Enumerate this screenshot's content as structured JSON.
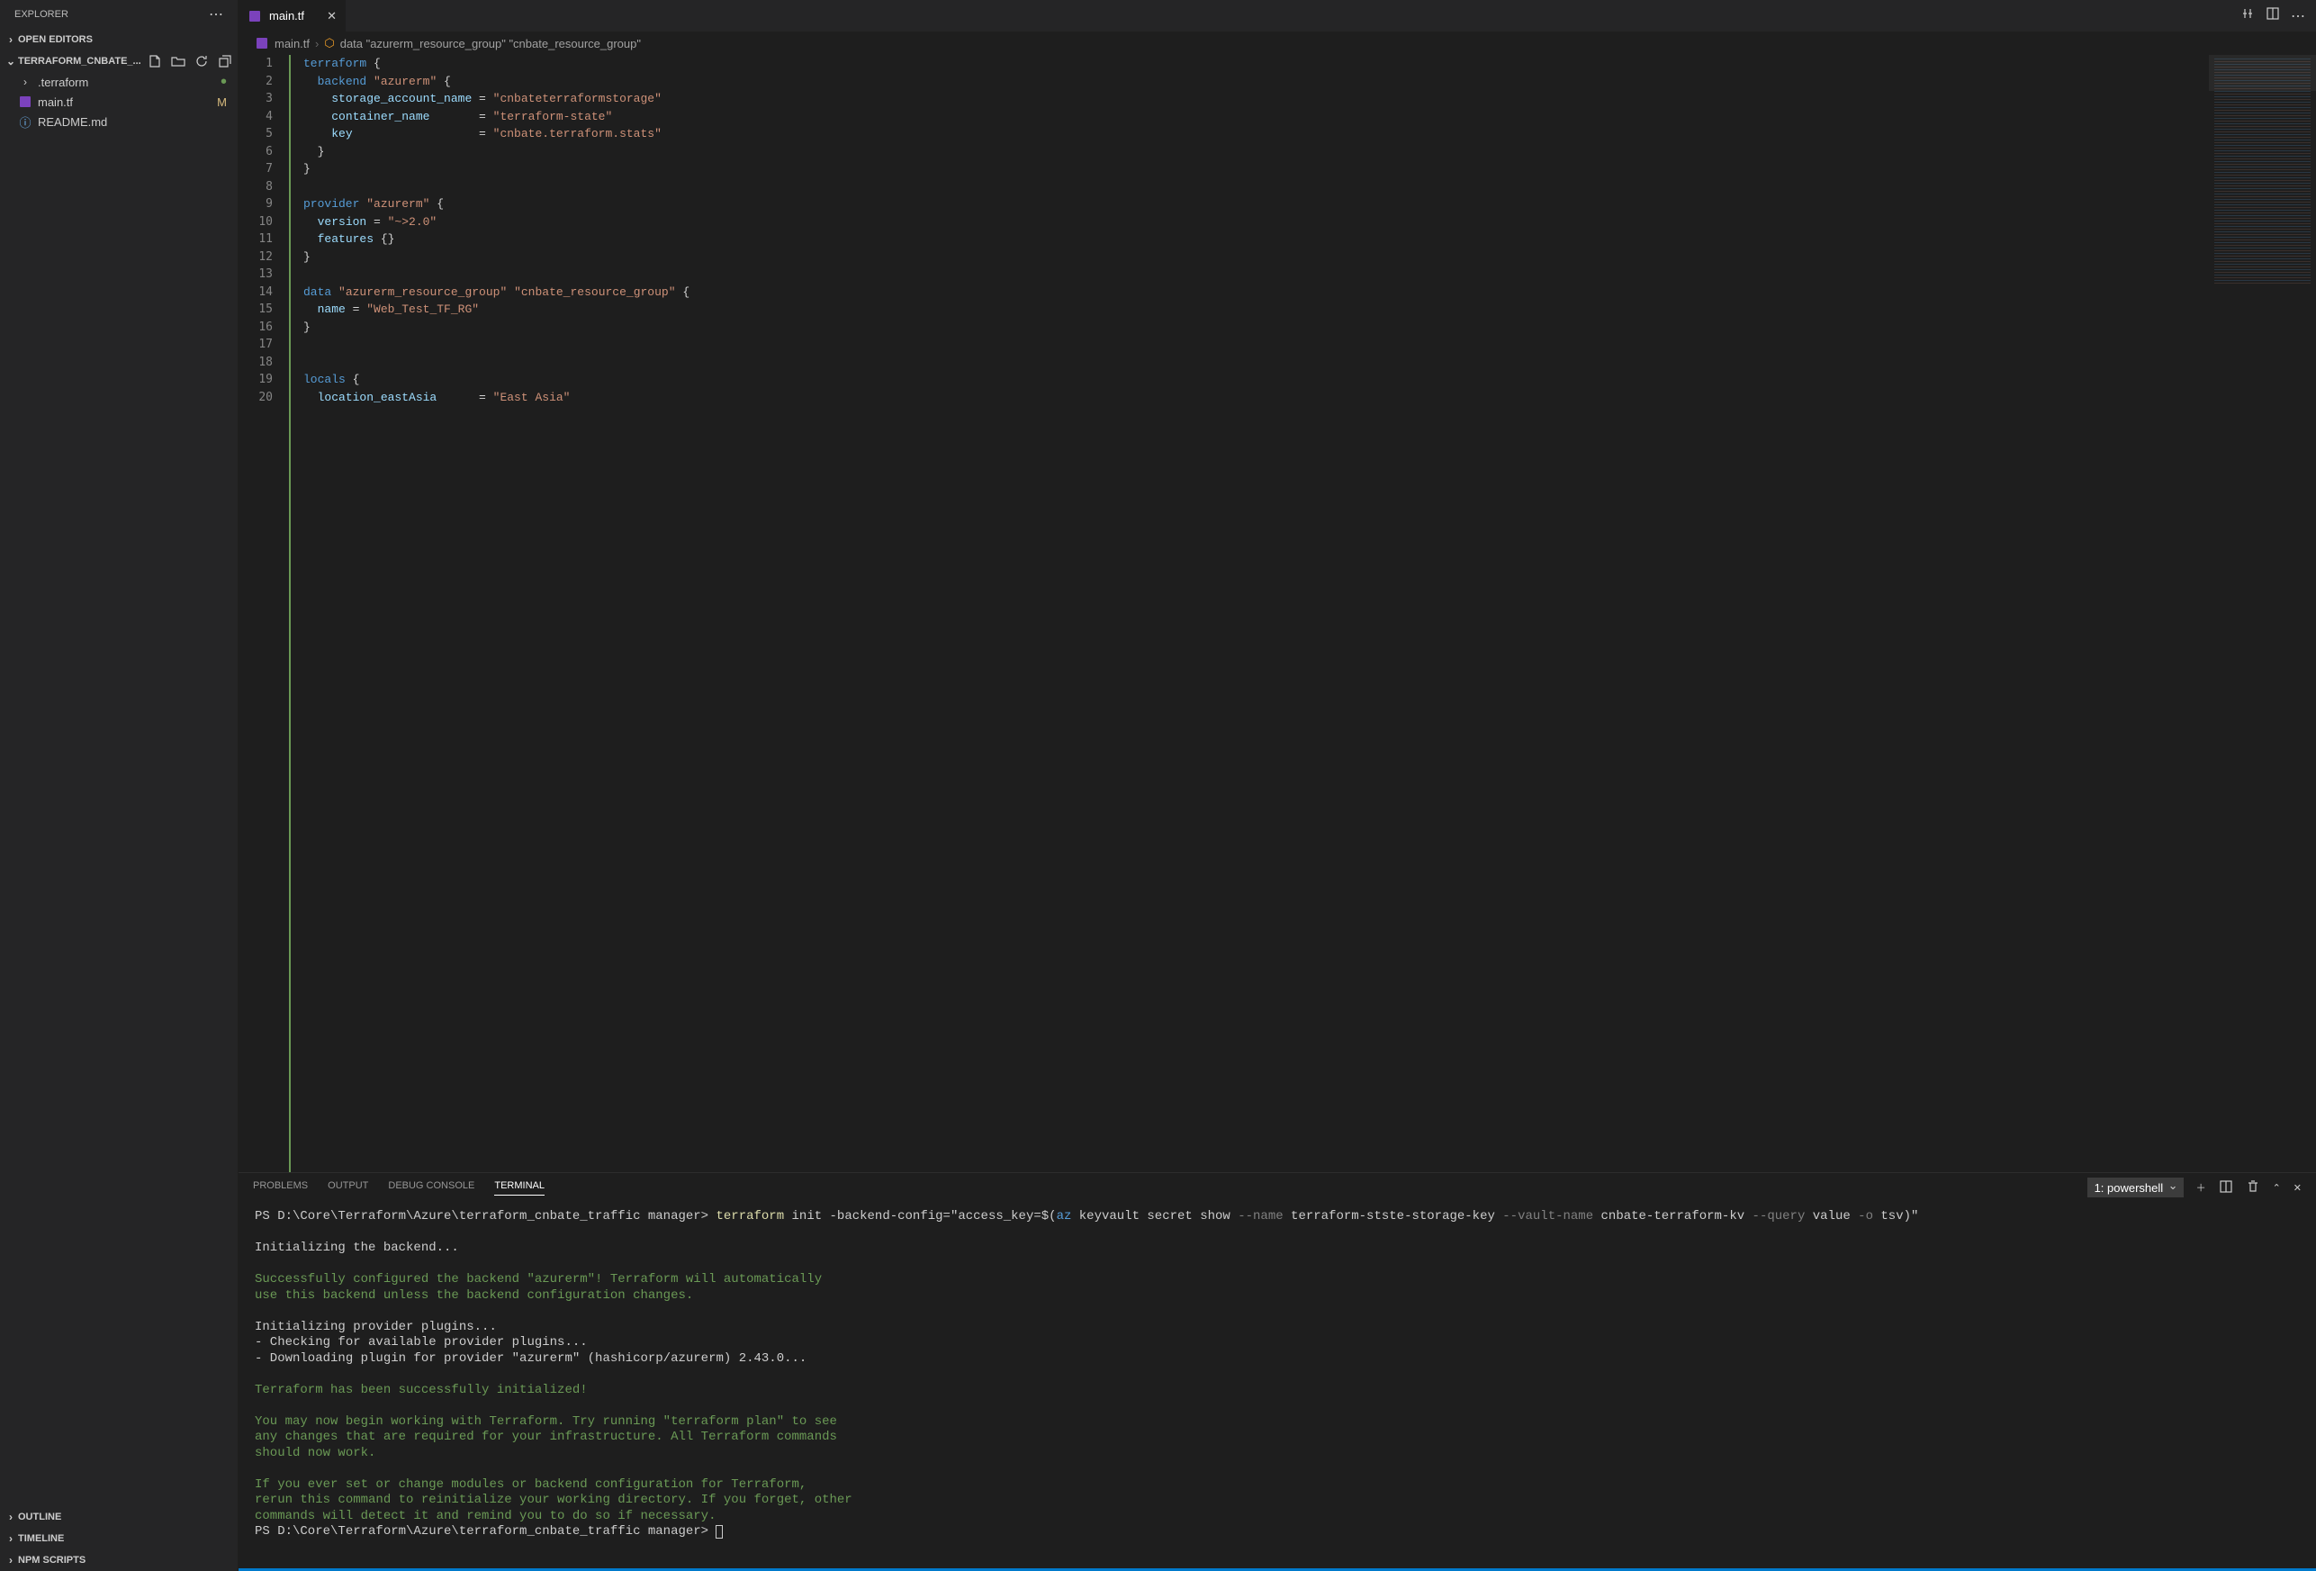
{
  "sidebar": {
    "title": "EXPLORER",
    "open_editors": "OPEN EDITORS",
    "project_name": "TERRAFORM_CNBATE_...",
    "files": [
      {
        "name": ".terraform",
        "type": "folder",
        "badge": "dot"
      },
      {
        "name": "main.tf",
        "type": "tf",
        "badge": "M"
      },
      {
        "name": "README.md",
        "type": "readme",
        "badge": ""
      }
    ],
    "outline": "OUTLINE",
    "timeline": "TIMELINE",
    "npm_scripts": "NPM SCRIPTS"
  },
  "tabs": {
    "active": "main.tf"
  },
  "breadcrumb": {
    "file": "main.tf",
    "symbol": "data \"azurerm_resource_group\" \"cnbate_resource_group\""
  },
  "code": {
    "lines": [
      [
        [
          "kw",
          "terraform"
        ],
        [
          "punct",
          " {"
        ]
      ],
      [
        [
          "punct",
          "  "
        ],
        [
          "kw",
          "backend"
        ],
        [
          "punct",
          " "
        ],
        [
          "str",
          "\"azurerm\""
        ],
        [
          "punct",
          " {"
        ]
      ],
      [
        [
          "punct",
          "    "
        ],
        [
          "prop",
          "storage_account_name"
        ],
        [
          "punct",
          " = "
        ],
        [
          "str",
          "\"cnbateterraformstorage\""
        ]
      ],
      [
        [
          "punct",
          "    "
        ],
        [
          "prop",
          "container_name"
        ],
        [
          "punct",
          "       = "
        ],
        [
          "str",
          "\"terraform-state\""
        ]
      ],
      [
        [
          "punct",
          "    "
        ],
        [
          "prop",
          "key"
        ],
        [
          "punct",
          "                  = "
        ],
        [
          "str",
          "\"cnbate.terraform.stats\""
        ]
      ],
      [
        [
          "punct",
          "  }"
        ]
      ],
      [
        [
          "punct",
          "}"
        ]
      ],
      [
        [
          "punct",
          ""
        ]
      ],
      [
        [
          "kw",
          "provider"
        ],
        [
          "punct",
          " "
        ],
        [
          "str",
          "\"azurerm\""
        ],
        [
          "punct",
          " {"
        ]
      ],
      [
        [
          "punct",
          "  "
        ],
        [
          "prop",
          "version"
        ],
        [
          "punct",
          " = "
        ],
        [
          "str",
          "\"~>2.0\""
        ]
      ],
      [
        [
          "punct",
          "  "
        ],
        [
          "prop",
          "features"
        ],
        [
          "punct",
          " {}"
        ]
      ],
      [
        [
          "punct",
          "}"
        ]
      ],
      [
        [
          "punct",
          ""
        ]
      ],
      [
        [
          "kw",
          "data"
        ],
        [
          "punct",
          " "
        ],
        [
          "str",
          "\"azurerm_resource_group\""
        ],
        [
          "punct",
          " "
        ],
        [
          "str",
          "\"cnbate_resource_group\""
        ],
        [
          "punct",
          " {"
        ]
      ],
      [
        [
          "punct",
          "  "
        ],
        [
          "prop",
          "name"
        ],
        [
          "punct",
          " = "
        ],
        [
          "str",
          "\"Web_Test_TF_RG\""
        ]
      ],
      [
        [
          "punct",
          "}"
        ]
      ],
      [
        [
          "punct",
          ""
        ]
      ],
      [
        [
          "punct",
          ""
        ]
      ],
      [
        [
          "kw",
          "locals"
        ],
        [
          "punct",
          " {"
        ]
      ],
      [
        [
          "punct",
          "  "
        ],
        [
          "prop",
          "location_eastAsia"
        ],
        [
          "punct",
          "      = "
        ],
        [
          "str",
          "\"East Asia\""
        ]
      ]
    ],
    "start_line": 1
  },
  "panel": {
    "tabs": [
      "PROBLEMS",
      "OUTPUT",
      "DEBUG CONSOLE",
      "TERMINAL"
    ],
    "active": "TERMINAL",
    "selector": "1: powershell"
  },
  "terminal": {
    "prompt": "PS D:\\Core\\Terraform\\Azure\\terraform_cnbate_traffic manager>",
    "command_parts": {
      "tf": "terraform",
      "rest1": " init -backend-config=\"access_key=$(",
      "az": "az",
      "rest2": " keyvault secret show ",
      "flag1": "--name",
      "val1": " terraform-stste-storage-key ",
      "flag2": "--vault-name",
      "val2": " cnbate-terraform-kv ",
      "flag3": "--query",
      "val3": " value ",
      "flag4": "-o",
      "val4": " tsv)\""
    },
    "lines": [
      "",
      [
        "white",
        "Initializing the backend..."
      ],
      "",
      [
        "green",
        "Successfully configured the backend \"azurerm\"! Terraform will automatically"
      ],
      [
        "green",
        "use this backend unless the backend configuration changes."
      ],
      "",
      [
        "white",
        "Initializing provider plugins..."
      ],
      [
        "white",
        "- Checking for available provider plugins..."
      ],
      [
        "white",
        "- Downloading plugin for provider \"azurerm\" (hashicorp/azurerm) 2.43.0..."
      ],
      "",
      [
        "green",
        "Terraform has been successfully initialized!"
      ],
      "",
      [
        "green",
        "You may now begin working with Terraform. Try running \"terraform plan\" to see"
      ],
      [
        "green",
        "any changes that are required for your infrastructure. All Terraform commands"
      ],
      [
        "green",
        "should now work."
      ],
      "",
      [
        "green",
        "If you ever set or change modules or backend configuration for Terraform,"
      ],
      [
        "green",
        "rerun this command to reinitialize your working directory. If you forget, other"
      ],
      [
        "green",
        "commands will detect it and remind you to do so if necessary."
      ]
    ]
  }
}
